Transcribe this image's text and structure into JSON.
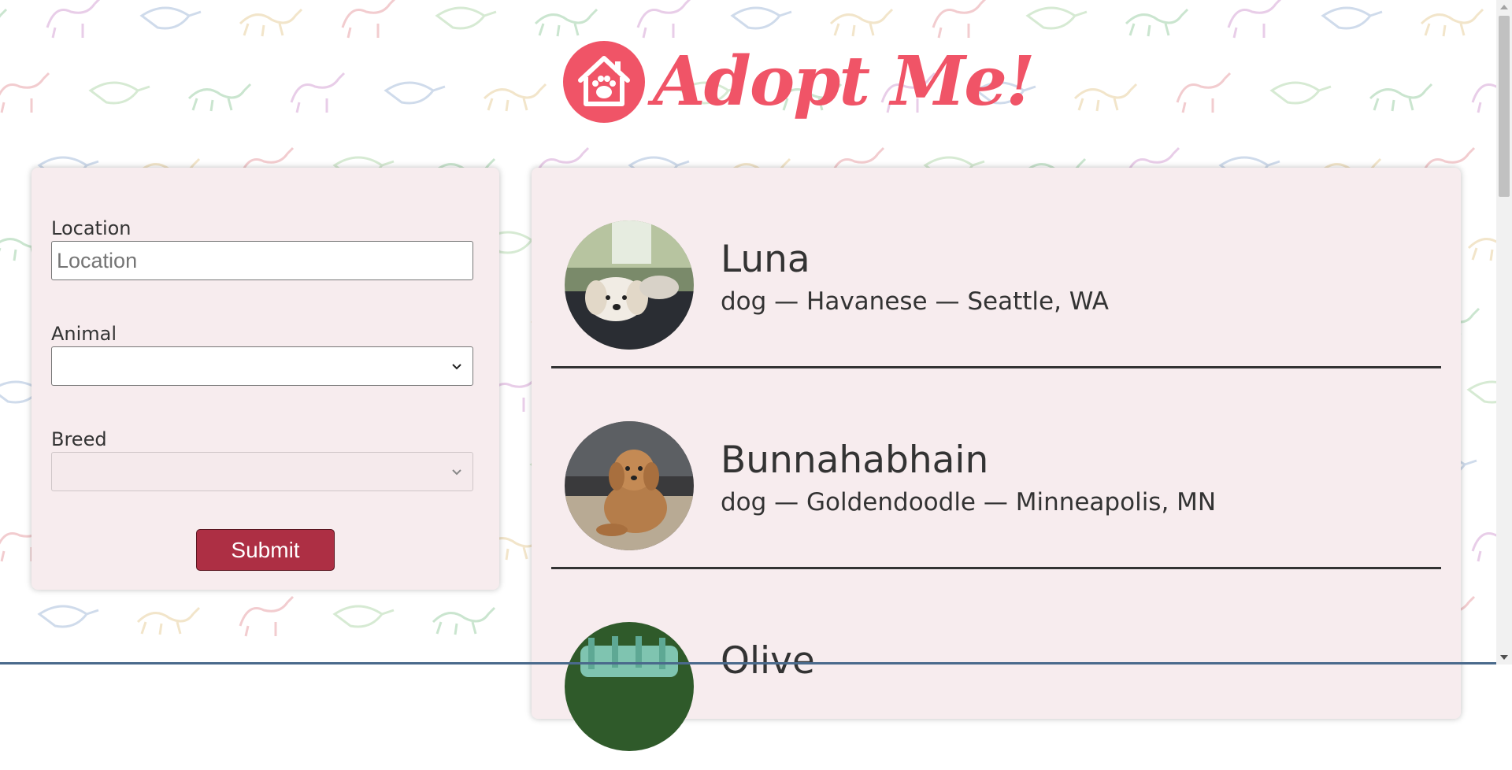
{
  "app": {
    "logo_text": "Adopt Me!",
    "brand_color": "#f05467",
    "accent_color": "#ad2f44",
    "panel_color": "#f7ecee"
  },
  "search": {
    "location_label": "Location",
    "location_placeholder": "Location",
    "location_value": "",
    "animal_label": "Animal",
    "animal_selected": "",
    "breed_label": "Breed",
    "breed_selected": "",
    "submit_label": "Submit"
  },
  "results": [
    {
      "name": "Luna",
      "info": "dog — Havanese — Seattle, WA"
    },
    {
      "name": "Bunnahabhain",
      "info": "dog — Goldendoodle — Minneapolis, MN"
    },
    {
      "name": "Olive",
      "info": ""
    }
  ]
}
